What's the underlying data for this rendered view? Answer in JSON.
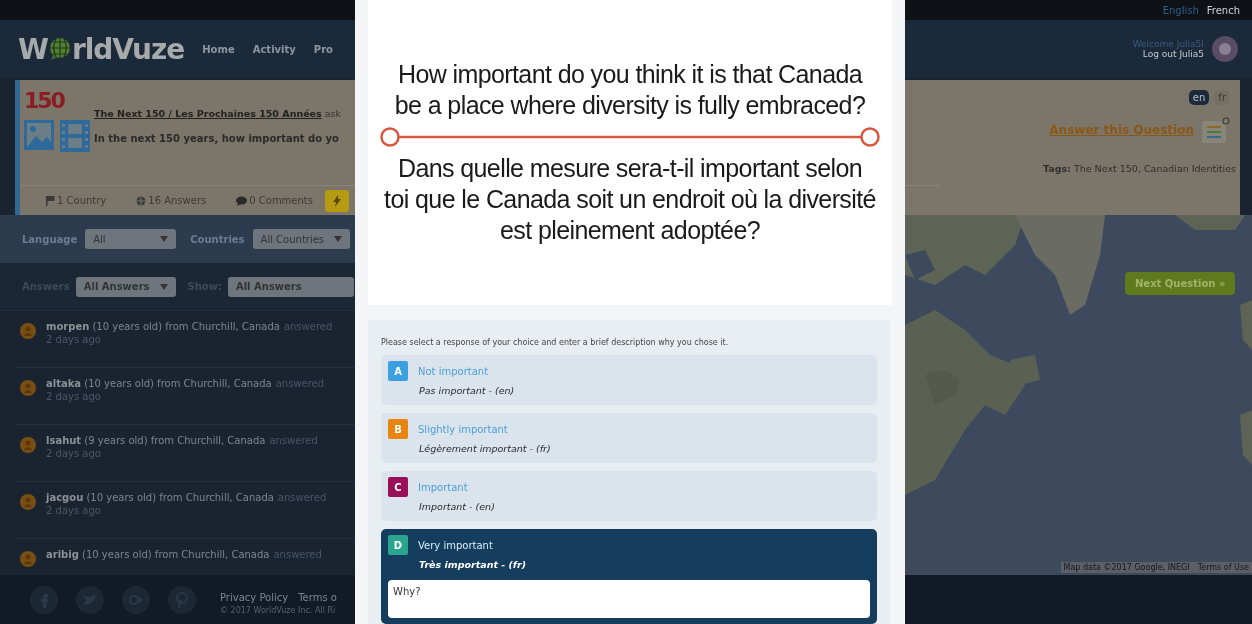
{
  "top_bar": {
    "languages": [
      {
        "label": "English",
        "selected": true
      },
      {
        "label": "French",
        "selected": false
      }
    ]
  },
  "header": {
    "logo": {
      "lead": "W",
      "rest": "rldVuze"
    },
    "nav": [
      "Home",
      "Activity",
      "Pro"
    ],
    "welcome": "Welcome Julia5I",
    "logout": "Log out Julia5"
  },
  "question_panel": {
    "logo_text": "150",
    "source_link": "The Next 150 / Les Prochaines 150 Années",
    "source_suffix": "ask",
    "question": "In the next 150 years, how important do yo",
    "stats": [
      {
        "kind": "flag",
        "label": "1 Country"
      },
      {
        "kind": "globe",
        "label": "16 Answers"
      },
      {
        "kind": "comment",
        "label": "0 Comments"
      }
    ],
    "languages": [
      {
        "label": "en",
        "selected": true
      },
      {
        "label": "fr",
        "selected": false
      }
    ],
    "answer_link": "Answer this Question",
    "tags_label": "Tags:",
    "tags": "The Next 150, Canadian Identities"
  },
  "filters": [
    {
      "label": "Language",
      "value": "All"
    },
    {
      "label": "Countries",
      "value": "All Countries"
    }
  ],
  "answers_bar": {
    "label": "Answers",
    "filter": "All Answers",
    "show_label": "Show:",
    "show_value": "All Answers"
  },
  "answers": [
    {
      "user": "**morpen** (10 years old) from Churchill, Canada",
      "status": "answered",
      "time": "2 days ago"
    },
    {
      "user": "**altaka** (10 years old) from Churchill, Canada",
      "status": "answered",
      "time": "2 days ago"
    },
    {
      "user": "**lsahut** (9 years old) from Churchill, Canada",
      "status": "answered",
      "time": "2 days ago"
    },
    {
      "user": "**jacgou** (10 years old) from Churchill, Canada",
      "status": "answered",
      "time": "2 days ago"
    },
    {
      "user": "**aribig** (10 years old) from Churchill, Canada",
      "status": "answered"
    }
  ],
  "footer": {
    "links": [
      "Privacy Policy",
      "Terms o"
    ],
    "copyright": "© 2017 WorldVuze Inc. All Ri"
  },
  "map": {
    "button": "Next Question »",
    "attribution": "Map data ©2017 Google, INEGI",
    "terms": "Terms of Use"
  },
  "dialog": {
    "question_en": "How important do you think it is that Canada be a place where diversity is fully embraced?",
    "question_fr": "Dans quelle mesure sera-t-il important selon toi que le Canada soit un endroit où la diversité est pleinement adoptée?",
    "instruction": "Please select a response of your choice and enter a brief description why you chose it.",
    "options": [
      {
        "letter": "A",
        "title": "Not important",
        "translation": "Pas important - (en)",
        "color": "#3aa0e0",
        "selected": false
      },
      {
        "letter": "B",
        "title": "Slightly important",
        "translation": "Légèrement important - (fr)",
        "color": "#e8850e",
        "selected": false
      },
      {
        "letter": "C",
        "title": "Important",
        "translation": "Important - (en)",
        "color": "#9a1058",
        "selected": false
      },
      {
        "letter": "D",
        "title": "Very important",
        "translation": "Très important - (fr)",
        "color": "#2aa58e",
        "selected": true
      }
    ],
    "reason_field": {
      "placeholder": "Why?"
    }
  }
}
